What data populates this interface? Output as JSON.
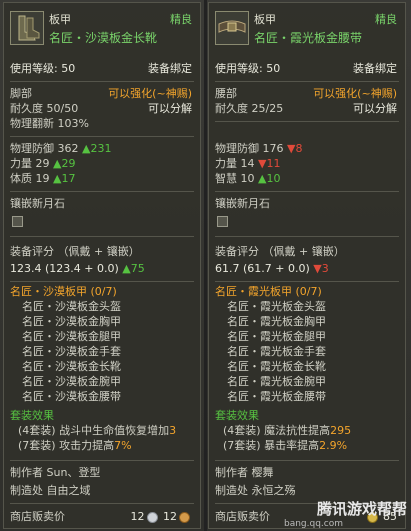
{
  "left": {
    "item_type": "板甲",
    "item_name": "名匠・沙漠板金长靴",
    "quality": "精良",
    "use_level": "使用等级: 50",
    "bind": "装备绑定",
    "slot": "脚部",
    "enhance": "可以强化(~神赐)",
    "durability": "耐久度 50/50",
    "decompose": "",
    "refine": "物理翻新 103%",
    "stats": [
      {
        "label": "物理防御",
        "value": "362",
        "delta": "▲231",
        "dir": "up"
      },
      {
        "label": "力量",
        "value": "29",
        "delta": "▲29",
        "dir": "up"
      },
      {
        "label": "体质",
        "value": "19",
        "delta": "▲17",
        "dir": "up"
      }
    ],
    "socket_label": "镶嵌新月石",
    "rating_label": "装备评分 （佩戴 + 镶嵌）",
    "rating_value": "123.4 (123.4 + 0.0)",
    "rating_delta": "▲75",
    "rating_dir": "up",
    "set_name": "名匠・沙漠板甲 (0/7)",
    "set_items": [
      "名匠・沙漠板金头盔",
      "名匠・沙漠板金胸甲",
      "名匠・沙漠板金腿甲",
      "名匠・沙漠板金手套",
      "名匠・沙漠板金长靴",
      "名匠・沙漠板金腕甲",
      "名匠・沙漠板金腰带"
    ],
    "set_effect_title": "套装效果",
    "set_effects": [
      {
        "pre": "(4套装) 战斗中生命值恢复增加",
        "val": "3"
      },
      {
        "pre": "(7套装) 攻击力提高",
        "val": "7%"
      }
    ],
    "maker": "制作者 Sun、登型",
    "made_at": "制造处 自由之域",
    "shop_label": "商店贩卖价",
    "price_a": "12",
    "price_b": "12"
  },
  "right": {
    "item_type": "板甲",
    "item_name": "名匠・霞光板金腰带",
    "quality": "精良",
    "use_level": "使用等级: 50",
    "bind": "装备绑定",
    "slot": "腰部",
    "enhance": "可以强化(~神赐)",
    "durability": "耐久度 25/25",
    "decompose": "可以分解",
    "refine": "",
    "stats": [
      {
        "label": "物理防御",
        "value": "176",
        "delta": "▼8",
        "dir": "down"
      },
      {
        "label": "力量",
        "value": "14",
        "delta": "▼11",
        "dir": "down"
      },
      {
        "label": "智慧",
        "value": "10",
        "delta": "▲10",
        "dir": "up"
      }
    ],
    "socket_label": "镶嵌新月石",
    "rating_label": "装备评分 （佩戴 + 镶嵌）",
    "rating_value": "61.7 (61.7 + 0.0)",
    "rating_delta": "▼3",
    "rating_dir": "down",
    "set_name": "名匠・霞光板甲 (0/7)",
    "set_items": [
      "名匠・霞光板金头盔",
      "名匠・霞光板金胸甲",
      "名匠・霞光板金腿甲",
      "名匠・霞光板金手套",
      "名匠・霞光板金长靴",
      "名匠・霞光板金腕甲",
      "名匠・霞光板金腰带"
    ],
    "set_effect_title": "套装效果",
    "set_effects": [
      {
        "pre": "(4套装) 魔法抗性提高",
        "val": "295"
      },
      {
        "pre": "(7套装) 暴击率提高",
        "val": "2.9%"
      }
    ],
    "maker": "制作者 樱舞",
    "made_at": "制造处 永恒之殇",
    "shop_label": "商店贩卖价",
    "price_a": "",
    "price_b": "85"
  },
  "left_decompose": "可以分解",
  "watermark": "腾讯游戏帮帮",
  "watermark_url": "bang.qq.com",
  "colors": {
    "good": "#79d36a",
    "orange": "#f2a42c",
    "up": "#56c241",
    "down": "#e04a3a"
  }
}
